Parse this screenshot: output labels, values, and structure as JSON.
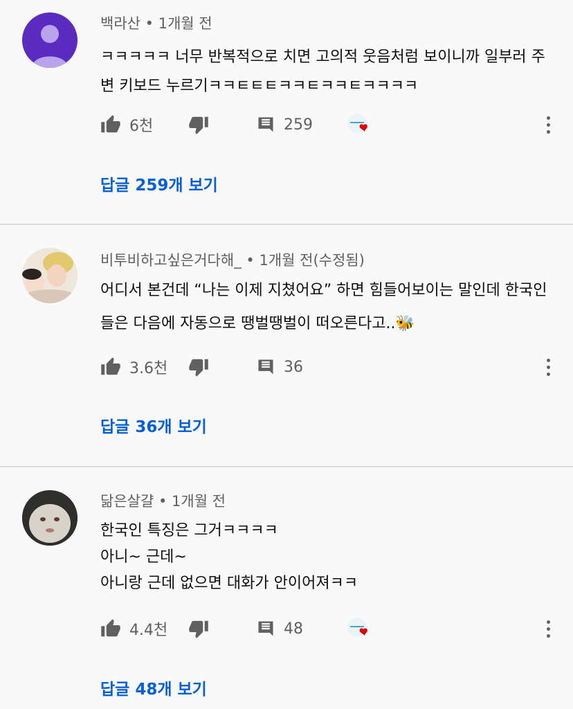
{
  "comments": [
    {
      "author": "백라산",
      "time": "1개월 전",
      "lines": [
        "ㅋㅋㅋㅋㅋ 너무 반복적으로 치면 고의적 웃음처럼 보이니까 일부러 주",
        "변 키보드 누르기ㅋㅋㅌㅌㅌㅋㅋㅌㅋㅋㅌㅋㅋㅋㅋ"
      ],
      "likes": "6천",
      "reply_count": "259",
      "replies_label": "답글 259개 보기",
      "avatar_icon": "default-person-icon",
      "hearted": true
    },
    {
      "author": "비투비하고싶은거다해_",
      "time": "1개월 전(수정됨)",
      "lines": [
        "어디서 본건데 “나는 이제 지쳤어요” 하면 힘들어보이는 말인데 한국인",
        "들은 다음에 자동으로 땡벌땡벌이 떠오른다고..🐝"
      ],
      "likes": "3.6천",
      "reply_count": "36",
      "replies_label": "답글 36개 보기",
      "avatar_icon": "photo-avatar",
      "hearted": false
    },
    {
      "author": "닮은살걀",
      "time": "1개월 전",
      "lines": [
        "한국인 특징은 그거ㅋㅋㅋㅋ",
        "아니~ 근데~",
        "아니랑 근데 없으면 대화가 안이어져ㅋㅋ"
      ],
      "likes": "4.4천",
      "reply_count": "48",
      "replies_label": "답글 48개 보기",
      "avatar_icon": "photo-avatar",
      "hearted": true
    }
  ],
  "separator": "•",
  "colors": {
    "background": "#f9f9f9",
    "link": "#065fd4",
    "meta": "#606060",
    "avatar_default": "#5b2bbf",
    "heart": "#e00000"
  }
}
